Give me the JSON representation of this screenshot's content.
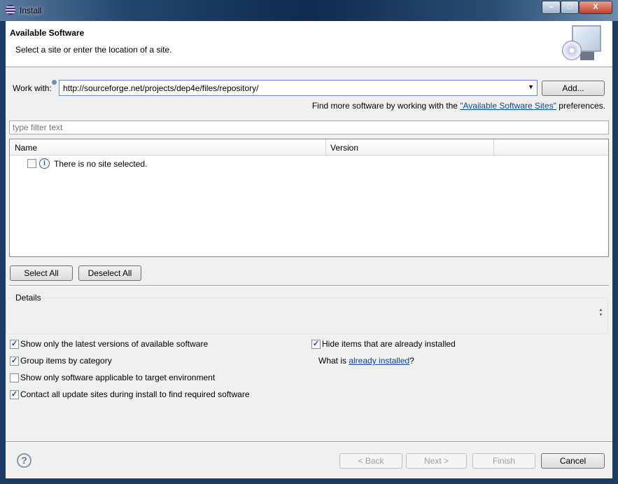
{
  "window": {
    "title": "Install",
    "minimize": "–",
    "maximize": "□",
    "close": "X"
  },
  "header": {
    "title": "Available Software",
    "subtitle": "Select a site or enter the location of a site."
  },
  "work_with": {
    "label": "Work with:",
    "value": "http://sourceforge.net/projects/dep4e/files/repository/",
    "add_button": "Add...",
    "hint_prefix": "Find more software by working with the ",
    "hint_link": "\"Available Software Sites\"",
    "hint_suffix": " preferences."
  },
  "filter": {
    "placeholder": "type filter text"
  },
  "table": {
    "columns": [
      "Name",
      "Version"
    ],
    "rows": [
      {
        "name": "There is no site selected.",
        "checked": false
      }
    ]
  },
  "buttons": {
    "select_all": "Select All",
    "deselect_all": "Deselect All"
  },
  "details": {
    "label": "Details"
  },
  "options": [
    {
      "label": "Show only the latest versions of available software",
      "checked": true
    },
    {
      "label": "Group items by category",
      "checked": true
    },
    {
      "label": "Show only software applicable to target environment",
      "checked": false
    },
    {
      "label": "Contact all update sites during install to find required software",
      "checked": true
    }
  ],
  "hide_installed": {
    "label": "Hide items that are already installed",
    "checked": true
  },
  "what_is": {
    "prefix": "What is ",
    "link": "already installed",
    "suffix": "?"
  },
  "footer": {
    "back": "< Back",
    "next": "Next >",
    "finish": "Finish",
    "cancel": "Cancel",
    "help": "?"
  }
}
